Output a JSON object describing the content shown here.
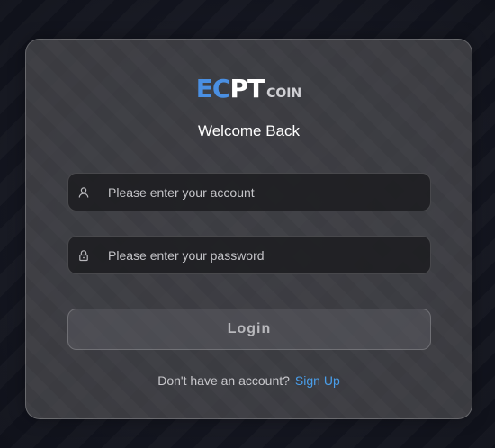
{
  "logo": {
    "part1": "EC",
    "part2": "PT",
    "suffix": "COIN",
    "colors": {
      "part1": "#4a8fe2",
      "part2": "#ffffff",
      "suffix": "#d0d0d4"
    }
  },
  "heading": "Welcome Back",
  "account_field": {
    "icon": "user-icon",
    "placeholder": "Please enter your account",
    "value": ""
  },
  "password_field": {
    "icon": "lock-icon",
    "placeholder": "Please enter your password",
    "value": ""
  },
  "login_button": {
    "label": "Login"
  },
  "signup": {
    "prompt": "Don't have an account?",
    "link": "Sign Up",
    "link_color": "#4a9eea"
  }
}
